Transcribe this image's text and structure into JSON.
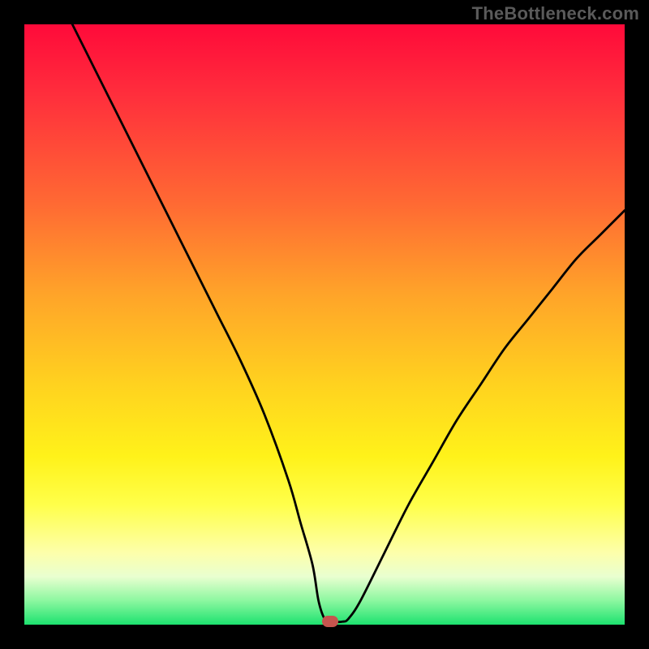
{
  "watermark": "TheBottleneck.com",
  "chart_data": {
    "type": "line",
    "title": "",
    "xlabel": "",
    "ylabel": "",
    "xlim": [
      0,
      100
    ],
    "ylim": [
      0,
      100
    ],
    "grid": false,
    "series": [
      {
        "name": "curve",
        "color": "#000000",
        "x": [
          8,
          12,
          16,
          20,
          24,
          28,
          32,
          36,
          40,
          44,
          46,
          48,
          49,
          50,
          51,
          53,
          54,
          56,
          60,
          64,
          68,
          72,
          76,
          80,
          84,
          88,
          92,
          96,
          100
        ],
        "y": [
          100,
          92,
          84,
          76,
          68,
          60,
          52,
          44,
          35,
          24,
          17,
          10,
          4,
          1,
          0.5,
          0.5,
          1,
          4,
          12,
          20,
          27,
          34,
          40,
          46,
          51,
          56,
          61,
          65,
          69
        ]
      }
    ],
    "annotations": [
      {
        "name": "marker",
        "x": 51,
        "y": 0.5,
        "shape": "pill",
        "color": "#c6544e"
      }
    ],
    "background_gradient": {
      "direction": "vertical",
      "stops": [
        {
          "pos": 0,
          "color": "#ff0a3a"
        },
        {
          "pos": 30,
          "color": "#ff6a33"
        },
        {
          "pos": 60,
          "color": "#ffd21f"
        },
        {
          "pos": 80,
          "color": "#ffff4a"
        },
        {
          "pos": 100,
          "color": "#1de26f"
        }
      ]
    }
  }
}
